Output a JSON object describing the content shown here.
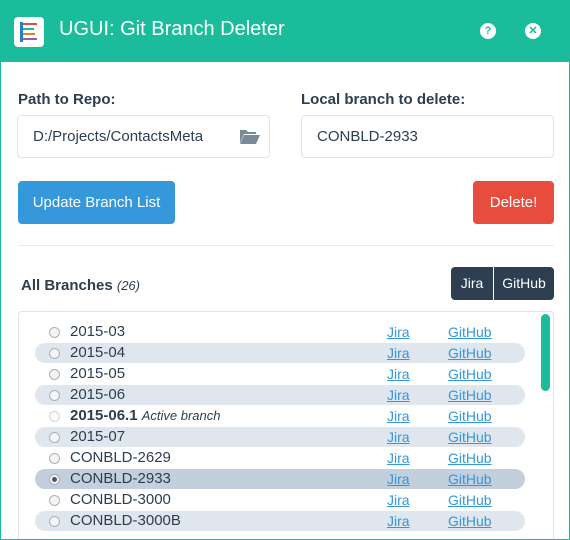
{
  "window": {
    "title": "UGUI: Git Branch Deleter"
  },
  "form": {
    "repo_label": "Path to Repo:",
    "repo_value": "D:/Projects/ContactsMeta",
    "branch_label": "Local branch to delete:",
    "branch_value": "CONBLD-2933",
    "update_label": "Update Branch List",
    "delete_label": "Delete!"
  },
  "branches": {
    "heading": "All Branches",
    "count": "(26)",
    "open_all_jira": "Jira",
    "open_all_github": "GitHub",
    "jira_label": "Jira",
    "github_label": "GitHub",
    "items": [
      {
        "name": "2015-03"
      },
      {
        "name": "2015-04"
      },
      {
        "name": "2015-05"
      },
      {
        "name": "2015-06"
      },
      {
        "name": "2015-06.1",
        "note": "Active branch"
      },
      {
        "name": "2015-07"
      },
      {
        "name": "CONBLD-2629"
      },
      {
        "name": "CONBLD-2933"
      },
      {
        "name": "CONBLD-3000"
      },
      {
        "name": "CONBLD-3000B"
      }
    ]
  },
  "colors": {
    "accent": "#1abc9c",
    "primary": "#3498db",
    "danger": "#e74c3c",
    "dark": "#2c3e50",
    "row_alt": "#dfe6ee",
    "row_selected": "#c3cfdc"
  },
  "icons": {
    "app": "app-logo-icon",
    "help": "help-icon",
    "close": "close-icon",
    "folder": "folder-open-icon"
  }
}
